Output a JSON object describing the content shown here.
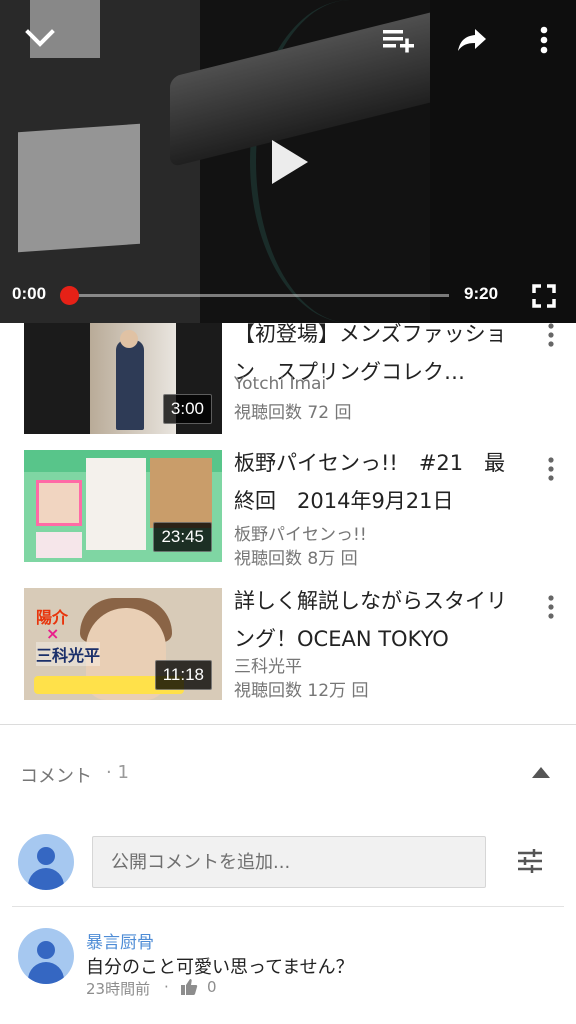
{
  "player": {
    "current_time": "0:00",
    "total_time": "9:20",
    "progress": 0.0,
    "icons": {
      "collapse": "chevron-down-icon",
      "add_to_queue": "playlist-add-icon",
      "share": "share-icon",
      "more": "more-vert-icon",
      "play": "play-icon",
      "fullscreen": "fullscreen-icon"
    },
    "accent_color": "#e62117"
  },
  "related": [
    {
      "title": "【初登場】メンズファッション　スプリングコレク…",
      "channel": "Yotchi Imai",
      "views": "視聴回数 72 回",
      "duration": "3:00"
    },
    {
      "title": "板野パイセンっ!!　#21　最終回　2014年9月21日",
      "channel": "板野パイセンっ!!",
      "views": "視聴回数 8万 回",
      "duration": "23:45"
    },
    {
      "title": "詳しく解説しながらスタイリング！OCEAN TOKYO",
      "channel": "三科光平",
      "views": "視聴回数 12万 回",
      "duration": "11:18",
      "thumb_text": [
        "陽介",
        "×",
        "三科光平"
      ]
    }
  ],
  "comments": {
    "header": "コメント",
    "count": "· 1",
    "input_placeholder": "公開コメントを追加...",
    "items": [
      {
        "author": "暴言厨骨",
        "text": "自分のこと可愛い思ってません？",
        "time": "23時間前",
        "separator": "·",
        "likes": "0"
      }
    ]
  },
  "colors": {
    "link_blue": "#4e8cd6",
    "avatar_bg": "#a6c8f0",
    "avatar_fg": "#3567c2"
  }
}
